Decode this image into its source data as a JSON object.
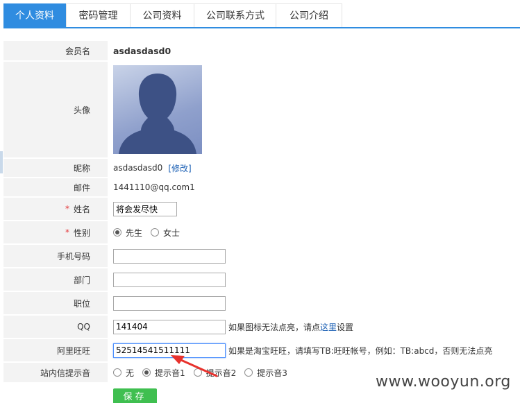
{
  "tabs": [
    {
      "label": "个人资料",
      "active": true
    },
    {
      "label": "密码管理"
    },
    {
      "label": "公司资料"
    },
    {
      "label": "公司联系方式"
    },
    {
      "label": "公司介绍"
    }
  ],
  "form": {
    "member_label": "会员名",
    "member_value": "asdasdasd0",
    "avatar_label": "头像",
    "nickname_label": "昵称",
    "nickname_value": "asdasdasd0",
    "nickname_edit": "[修改]",
    "email_label": "邮件",
    "email_value": "1441110@qq.com1",
    "required_mark": "*",
    "name_label": "姓名",
    "name_value": "将会发尽快",
    "gender_label": "性别",
    "gender_male": "先生",
    "gender_female": "女士",
    "mobile_label": "手机号码",
    "mobile_value": "",
    "dept_label": "部门",
    "dept_value": "",
    "position_label": "职位",
    "position_value": "",
    "qq_label": "QQ",
    "qq_value": "141404",
    "qq_hint_pre": "如果图标无法点亮，请点",
    "qq_hint_link": "这里",
    "qq_hint_post": "设置",
    "ww_label": "阿里旺旺",
    "ww_value": "52514541511111",
    "ww_hint": "如果是淘宝旺旺，请填写TB:旺旺帐号，例如：TB:abcd，否则无法点亮",
    "notify_label": "站内信提示音",
    "notify_options": [
      "无",
      "提示音1",
      "提示音2",
      "提示音3"
    ],
    "notify_selected": 1,
    "save_label": "保存"
  },
  "watermark": "www.wooyun.org",
  "colors": {
    "accent": "#2f8ce0",
    "save": "#3fbf50",
    "required": "#e4393c",
    "arrow": "#e8322d"
  }
}
